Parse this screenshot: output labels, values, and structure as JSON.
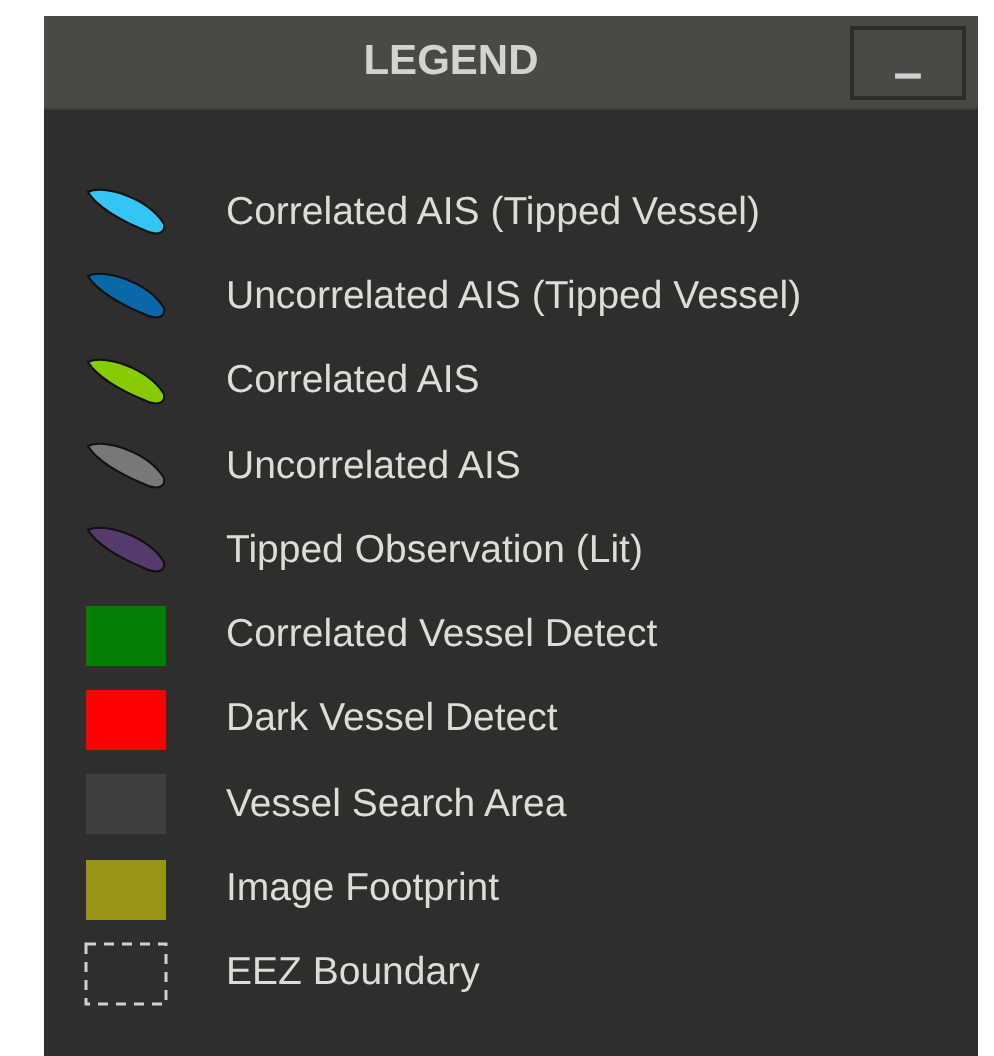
{
  "panel": {
    "title": "LEGEND",
    "minimize_button": {
      "label": "–"
    }
  },
  "items": [
    {
      "label": "Correlated AIS (Tipped Vessel)",
      "kind": "leaf",
      "color": "#33c6f5"
    },
    {
      "label": "Uncorrelated AIS (Tipped Vessel)",
      "kind": "leaf",
      "color": "#0a68a8"
    },
    {
      "label": "Correlated AIS",
      "kind": "leaf",
      "color": "#88cc00"
    },
    {
      "label": "Uncorrelated AIS",
      "kind": "leaf",
      "color": "#787878"
    },
    {
      "label": "Tipped Observation (Lit)",
      "kind": "leaf",
      "color": "#553a6e"
    },
    {
      "label": "Correlated Vessel Detect",
      "kind": "square",
      "color": "#037f03"
    },
    {
      "label": "Dark Vessel Detect",
      "kind": "square",
      "color": "#fe0000"
    },
    {
      "label": "Vessel Search Area",
      "kind": "square",
      "color": "#3f3f3f"
    },
    {
      "label": "Image Footprint",
      "kind": "square",
      "color": "#989415"
    },
    {
      "label": "EEZ Boundary",
      "kind": "dashed",
      "color": "#d0d0d0"
    }
  ]
}
